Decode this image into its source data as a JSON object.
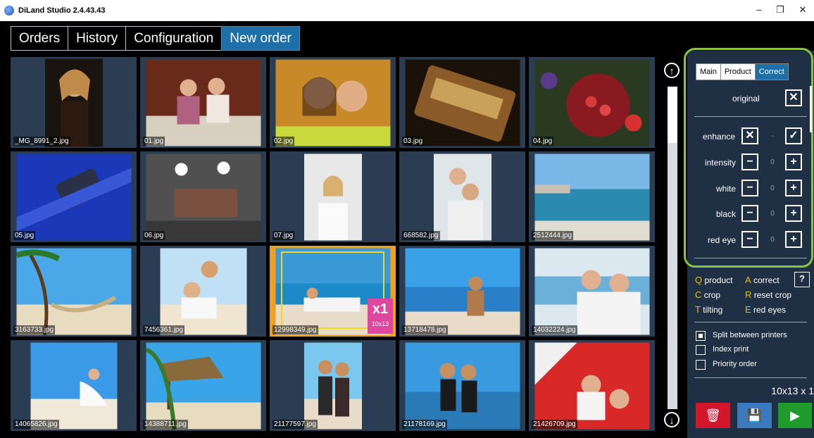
{
  "window": {
    "title": "DiLand Studio 2.4.43.43",
    "minimize": "–",
    "restore": "❐",
    "close": "✕"
  },
  "tabs": [
    {
      "label": "Orders"
    },
    {
      "label": "History"
    },
    {
      "label": "Configuration"
    },
    {
      "label": "New order"
    }
  ],
  "photos": [
    {
      "name": "_MG_8991_2.jpg"
    },
    {
      "name": "01.jpg"
    },
    {
      "name": "02.jpg"
    },
    {
      "name": "03.jpg"
    },
    {
      "name": "04.jpg"
    },
    {
      "name": "05.jpg"
    },
    {
      "name": "06.jpg"
    },
    {
      "name": "07.jpg"
    },
    {
      "name": "668582.jpg"
    },
    {
      "name": "2512444.jpg"
    },
    {
      "name": "3163733.jpg"
    },
    {
      "name": "7456361.jpg"
    },
    {
      "name": "12998349.jpg",
      "badge_count": "x1",
      "badge_size": "10x13"
    },
    {
      "name": "13718478.jpg"
    },
    {
      "name": "14032224.jpg"
    },
    {
      "name": "14065826.jpg"
    },
    {
      "name": "14388711.jpg"
    },
    {
      "name": "21177597.jpg"
    },
    {
      "name": "21178169.jpg"
    },
    {
      "name": "21426709.jpg"
    }
  ],
  "panel": {
    "tabs": [
      {
        "label": "Main"
      },
      {
        "label": "Product"
      },
      {
        "label": "Correct"
      }
    ],
    "original_label": "original",
    "enhance_label": "enhance",
    "enhance_sep": "-",
    "adjustments": [
      {
        "label": "intensity",
        "value": "0"
      },
      {
        "label": "white",
        "value": "0"
      },
      {
        "label": "black",
        "value": "0"
      },
      {
        "label": "red eye",
        "value": "0"
      }
    ],
    "shortcuts": [
      {
        "key": "Q",
        "text": " product"
      },
      {
        "key": "A",
        "text": " correct"
      },
      {
        "key": "C",
        "text": " crop"
      },
      {
        "key": "R",
        "text": " reset crop"
      },
      {
        "key": "T",
        "text": " tilting"
      },
      {
        "key": "E",
        "text": " red eyes"
      }
    ],
    "help_button": "?",
    "options": [
      {
        "label": "Split between printers",
        "checked": true
      },
      {
        "label": "Index print",
        "checked": false
      },
      {
        "label": "Priority order",
        "checked": false
      }
    ],
    "summary": "10x13 x 1"
  },
  "colors": {
    "accent": "#1d6fa8",
    "highlight": "#86c441",
    "delete": "#d4162c",
    "save": "#3a7bbf",
    "run": "#1f9a2c",
    "badge": "#e046a0"
  }
}
